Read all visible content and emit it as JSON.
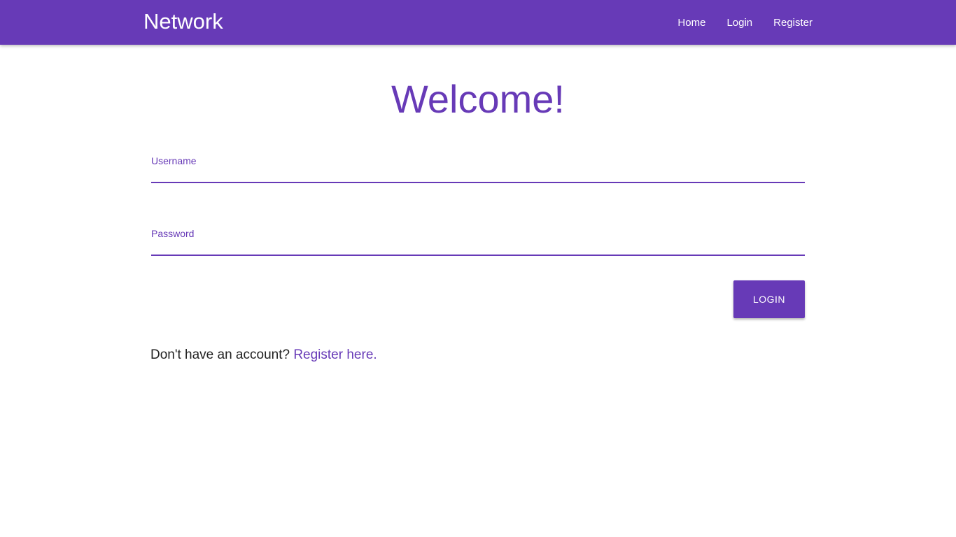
{
  "navbar": {
    "brand": "Network",
    "links": [
      "Home",
      "Login",
      "Register"
    ]
  },
  "main": {
    "heading": "Welcome!",
    "username_label": "Username",
    "password_label": "Password",
    "login_button": "LOGIN",
    "register_prompt": "Don't have an account?",
    "register_link": "Register here."
  },
  "colors": {
    "primary": "#673ab7",
    "text": "#222222",
    "background": "#ffffff"
  }
}
